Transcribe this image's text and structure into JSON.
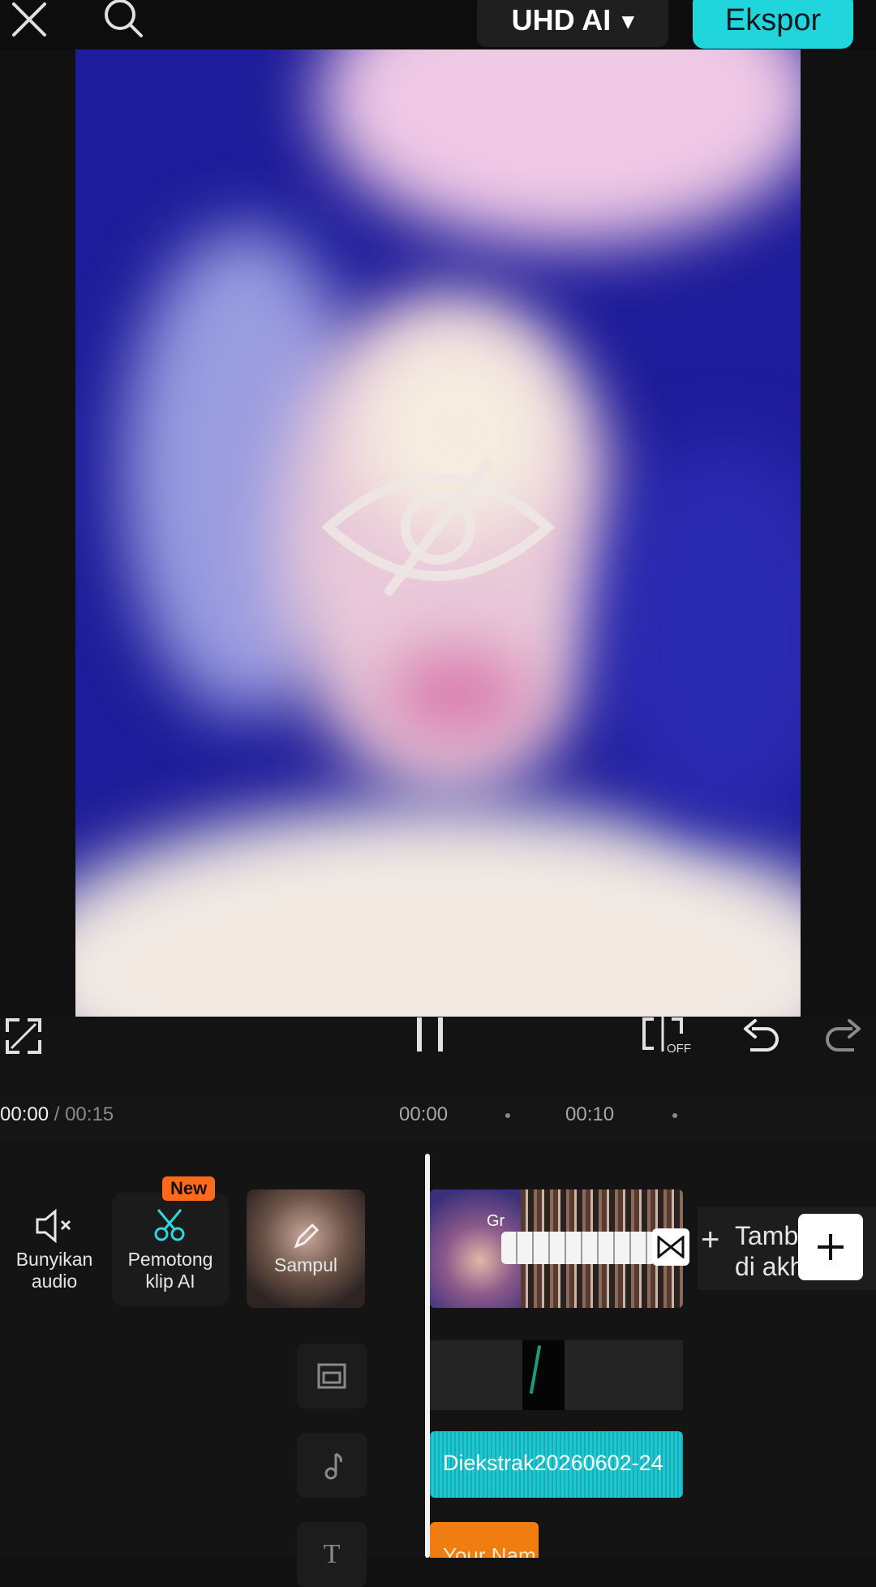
{
  "topbar": {
    "close_icon": "close-icon",
    "search_icon": "search-icon",
    "quality_label": "UHD AI",
    "quality_caret": "▾",
    "export_label": "Ekspor"
  },
  "preview": {
    "overlay_icon": "eye-off-icon"
  },
  "controls": {
    "fullscreen_icon": "fullscreen-icon",
    "pause_icon": "pause-icon",
    "keyframe_icon": "keyframe-off-icon",
    "keyframe_badge": "OFF",
    "undo_icon": "undo-icon",
    "redo_icon": "redo-icon"
  },
  "timeline": {
    "current_time": "00:00",
    "separator": " / ",
    "total_time": "00:15",
    "ruler": [
      "00:00",
      "00:10"
    ],
    "tools": [
      {
        "label": "Bunyikan audio",
        "icon": "speaker-mute-icon"
      },
      {
        "label": "Pemotong klip AI",
        "icon": "scissors-ai-icon",
        "badge": "New"
      },
      {
        "label": "Sampul",
        "icon": "pencil-icon"
      }
    ],
    "add_end_label": "Tambah di akhir",
    "add_icon": "plus-icon",
    "transition_icon": "transition-icon",
    "clip_thumb_text": "Gr",
    "audio_clip_label": "Diekstrak20260602-24",
    "text_clip_label": "Your Nam",
    "lanes": [
      "overlay-lane-icon",
      "music-note-icon",
      "text-lane-icon"
    ]
  },
  "colors": {
    "accent": "#20d5dc",
    "audio_clip": "#1ec8d2",
    "text_clip": "#f07d12",
    "badge": "#ff6a1a"
  }
}
